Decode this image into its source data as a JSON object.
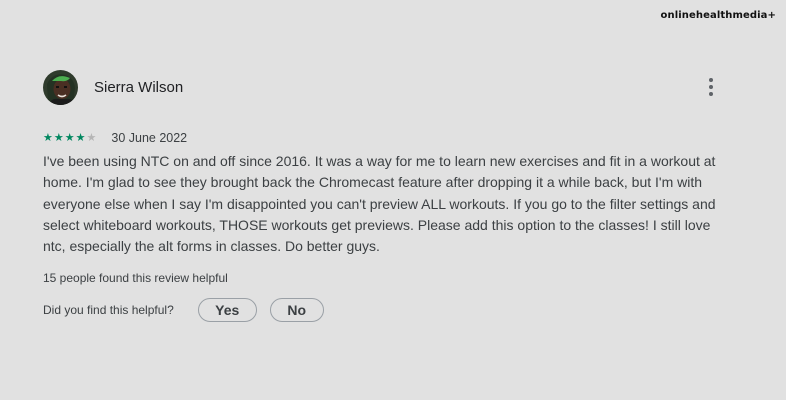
{
  "watermark": {
    "text": "onlinehealthmedia+"
  },
  "review": {
    "author": "Sierra Wilson",
    "avatar_icon": "user-avatar",
    "more_icon": "more-vert-icon",
    "rating": 4,
    "rating_max": 5,
    "star_icon": "star-icon",
    "date": "30 June 2022",
    "text": "I've been using NTC on and off since 2016. It was a way for me to learn new exercises and fit in a workout at home. I'm glad to see they brought back the Chromecast feature after dropping it a while back, but I'm with everyone else when I say I'm disappointed you can't preview ALL workouts. If you go to the filter settings and select whiteboard workouts, THOSE workouts get previews. Please add this option to the classes! I still love ntc, especially the alt forms in classes. Do better guys.",
    "helpful_count_text": "15 people found this review helpful",
    "helpful_question": "Did you find this helpful?",
    "yes_label": "Yes",
    "no_label": "No"
  },
  "colors": {
    "background": "#e1e1e1",
    "star_filled": "#01875f",
    "star_empty": "#b5b5b5",
    "text_primary": "#202124",
    "text_secondary": "#3c4043",
    "pill_border": "#9aa0a6"
  }
}
